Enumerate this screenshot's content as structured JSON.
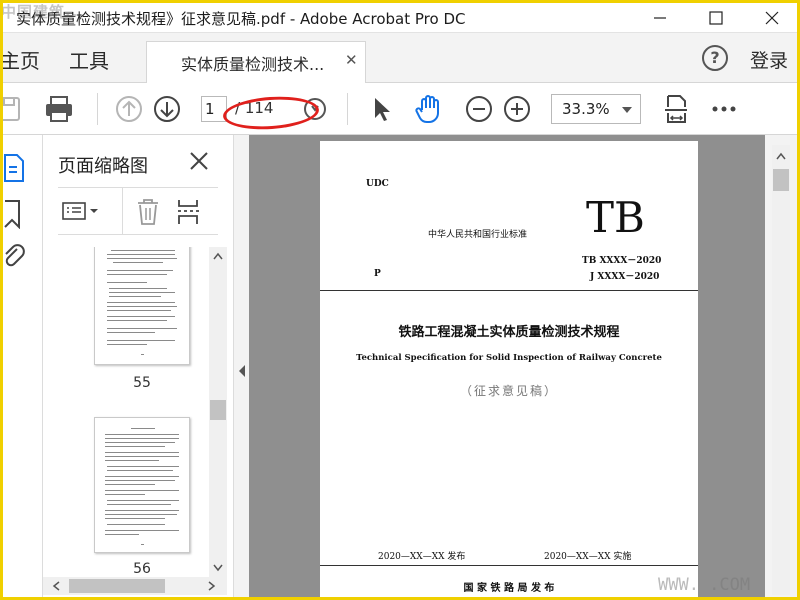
{
  "window": {
    "title": "实体质量检测技术规程》征求意见稿.pdf - Adobe Acrobat Pro DC",
    "watermark_top": "中国建筑..."
  },
  "tabs": {
    "home": "主页",
    "tools": "工具",
    "document": "实体质量检测技术...",
    "login": "登录",
    "help": "?"
  },
  "toolbar": {
    "current_page": "1",
    "total_pages": "/ 114",
    "zoom": "33.3%"
  },
  "thumbnails": {
    "title": "页面缩略图",
    "pages": [
      {
        "label": "55"
      },
      {
        "label": "56"
      }
    ]
  },
  "document": {
    "udc": "UDC",
    "issuer": "中华人民共和国行业标准",
    "code": "TB",
    "std_no1": "TB XXXX－2020",
    "p": "P",
    "std_no2": "J XXXX－2020",
    "title_cn": "铁路工程混凝土实体质量检测技术规程",
    "title_en": "Technical Specification for Solid Inspection of Railway Concrete",
    "draft": "（征求意见稿）",
    "publish_date": "2020—XX—XX  发布",
    "effective_date": "2020—XX—XX  实施",
    "authority": "国  家  铁  路  局      发  布"
  },
  "watermark_bottom": "WWW.         .COM",
  "colors": {
    "frame": "#f0d000",
    "annotation": "#e0201c",
    "accent": "#1473e6"
  }
}
